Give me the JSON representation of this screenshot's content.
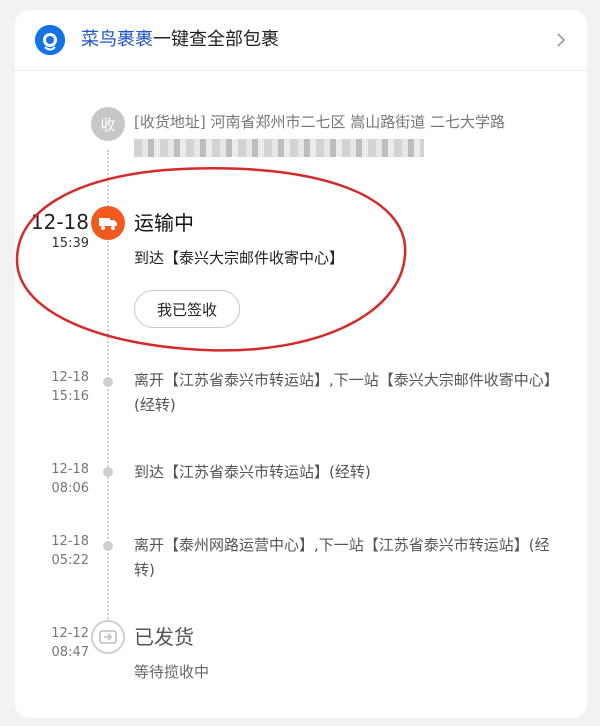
{
  "header": {
    "brand": "菜鸟裹裹",
    "title_rest": "一键查全部包裹",
    "logo_icon": "cainiao-logo-icon",
    "chevron_icon": "chevron-right-icon"
  },
  "address": {
    "badge_text": "收",
    "text": "[收货地址] 河南省郑州市二七区 嵩山路街道 二七大学路",
    "redacted_note": ""
  },
  "current": {
    "date": "12-18",
    "time": "15:39",
    "title": "运输中",
    "desc": "到达【泰兴大宗邮件收寄中心】",
    "button": "我已签收",
    "icon": "truck-icon"
  },
  "events": [
    {
      "date": "12-18",
      "time": "15:16",
      "text": "离开【江苏省泰兴市转运站】,下一站【泰兴大宗邮件收寄中心】(经转)"
    },
    {
      "date": "12-18",
      "time": "08:06",
      "text": "到达【江苏省泰兴市转运站】(经转)"
    },
    {
      "date": "12-18",
      "time": "05:22",
      "text": "离开【泰州网路运营中心】,下一站【江苏省泰兴市转运站】(经转)"
    }
  ],
  "shipped": {
    "date": "12-12",
    "time": "08:47",
    "title": "已发货",
    "desc": "等待揽收中",
    "icon": "package-sent-icon"
  },
  "colors": {
    "accent": "#f15a1e",
    "brand": "#1e55c8",
    "annotation": "#d42a2a"
  }
}
